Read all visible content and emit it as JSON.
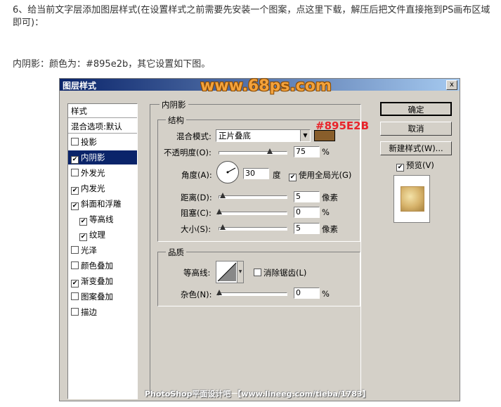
{
  "intro": {
    "text": "6、给当前文字层添加图层样式(在设置样式之前需要先安装一个图案，点这里下载，解压后把文件直接拖到PS画布区域即可)：",
    "shadow_note": "内阴影：颜色为：#895e2b，其它设置如下图。"
  },
  "dialog": {
    "title": "图层样式",
    "close": "x",
    "watermark": "www.68ps.com",
    "left_panel": {
      "header": "样式",
      "blend_default": "混合选项:默认",
      "items": [
        {
          "label": "投影",
          "checked": false
        },
        {
          "label": "内阴影",
          "checked": true,
          "selected": true
        },
        {
          "label": "外发光",
          "checked": false
        },
        {
          "label": "内发光",
          "checked": true
        },
        {
          "label": "斜面和浮雕",
          "checked": true
        },
        {
          "label": "等高线",
          "checked": true,
          "sub": true
        },
        {
          "label": "纹理",
          "checked": true,
          "sub": true
        },
        {
          "label": "光泽",
          "checked": false
        },
        {
          "label": "颜色叠加",
          "checked": false
        },
        {
          "label": "渐变叠加",
          "checked": true
        },
        {
          "label": "图案叠加",
          "checked": false
        },
        {
          "label": "描边",
          "checked": false
        }
      ]
    },
    "inner_shadow": {
      "section_title": "内阴影",
      "structure_title": "结构",
      "color_annotation": "#895E2B",
      "color_hex": "#895e2b",
      "blend_mode_label": "混合模式:",
      "blend_mode_value": "正片叠底",
      "opacity_label": "不透明度(O):",
      "opacity_value": "75",
      "opacity_unit": "%",
      "angle_label": "角度(A):",
      "angle_value": "30",
      "angle_unit": "度",
      "global_light_label": "使用全局光(G)",
      "global_light_checked": true,
      "distance_label": "距离(D):",
      "distance_value": "5",
      "distance_unit": "像素",
      "choke_label": "阻塞(C):",
      "choke_value": "0",
      "choke_unit": "%",
      "size_label": "大小(S):",
      "size_value": "5",
      "size_unit": "像素"
    },
    "quality": {
      "title": "品质",
      "contour_label": "等高线:",
      "antialias_label": "消除锯齿(L)",
      "antialias_checked": false,
      "noise_label": "杂色(N):",
      "noise_value": "0",
      "noise_unit": "%"
    },
    "buttons": {
      "ok": "确定",
      "cancel": "取消",
      "new_style": "新建样式(W)...",
      "preview_label": "预览(V)",
      "preview_checked": true
    }
  },
  "footer": "PhotoShop平面设计吧 【www.lineeg.com/tieba/1783】"
}
